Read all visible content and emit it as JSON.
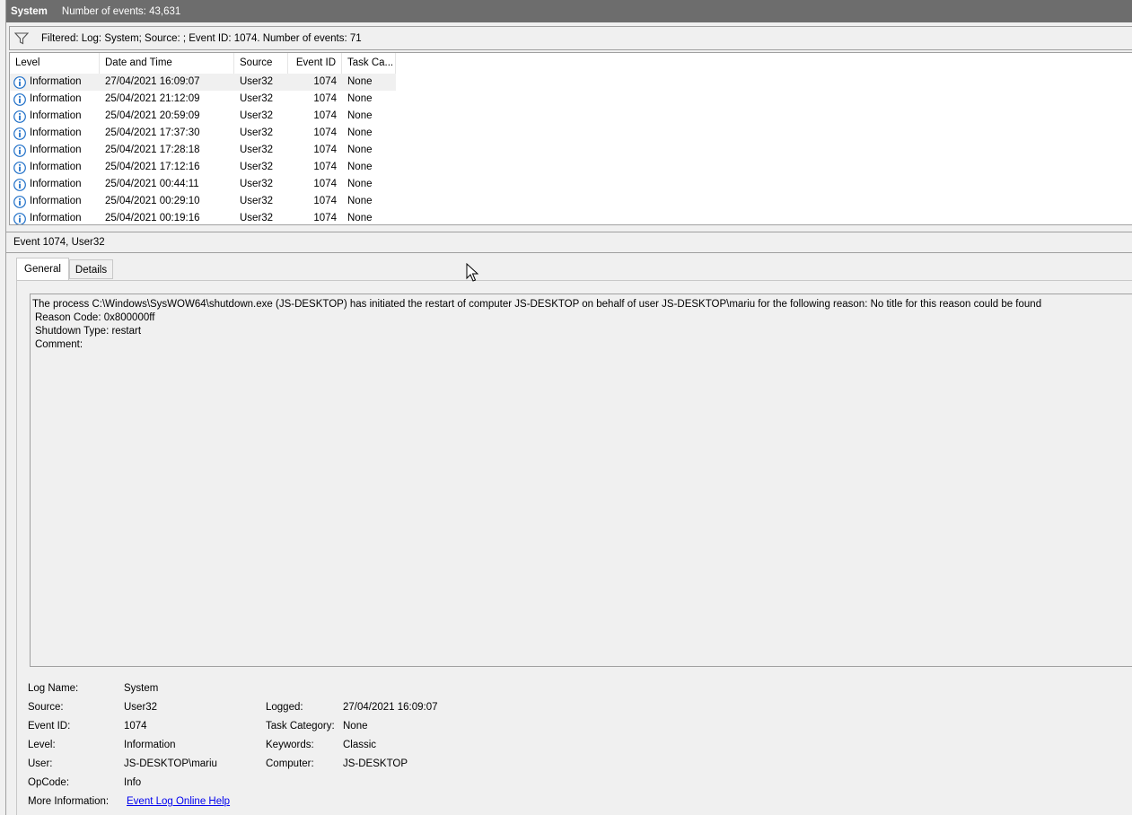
{
  "header": {
    "log_name": "System",
    "event_count": "Number of events: 43,631"
  },
  "filter": {
    "icon": "funnel-icon",
    "text": "Filtered: Log: System; Source: ; Event ID: 1074. Number of events: 71"
  },
  "grid": {
    "columns": [
      "Level",
      "Date and Time",
      "Source",
      "Event ID",
      "Task Ca..."
    ],
    "rows": [
      {
        "level": "Information",
        "date": "27/04/2021 16:09:07",
        "source": "User32",
        "event_id": "1074",
        "task": "None"
      },
      {
        "level": "Information",
        "date": "25/04/2021 21:12:09",
        "source": "User32",
        "event_id": "1074",
        "task": "None"
      },
      {
        "level": "Information",
        "date": "25/04/2021 20:59:09",
        "source": "User32",
        "event_id": "1074",
        "task": "None"
      },
      {
        "level": "Information",
        "date": "25/04/2021 17:37:30",
        "source": "User32",
        "event_id": "1074",
        "task": "None"
      },
      {
        "level": "Information",
        "date": "25/04/2021 17:28:18",
        "source": "User32",
        "event_id": "1074",
        "task": "None"
      },
      {
        "level": "Information",
        "date": "25/04/2021 17:12:16",
        "source": "User32",
        "event_id": "1074",
        "task": "None"
      },
      {
        "level": "Information",
        "date": "25/04/2021 00:44:11",
        "source": "User32",
        "event_id": "1074",
        "task": "None"
      },
      {
        "level": "Information",
        "date": "25/04/2021 00:29:10",
        "source": "User32",
        "event_id": "1074",
        "task": "None"
      },
      {
        "level": "Information",
        "date": "25/04/2021 00:19:16",
        "source": "User32",
        "event_id": "1074",
        "task": "None"
      }
    ]
  },
  "detail": {
    "title": "Event 1074, User32",
    "tabs": [
      "General",
      "Details"
    ],
    "message": [
      "The process C:\\Windows\\SysWOW64\\shutdown.exe (JS-DESKTOP) has initiated the restart of computer JS-DESKTOP on behalf of user JS-DESKTOP\\mariu for the following reason: No title for this reason could be found",
      "Reason Code: 0x800000ff",
      "Shutdown Type: restart",
      "Comment:"
    ],
    "props": {
      "log_name_label": "Log Name:",
      "log_name": "System",
      "source_label": "Source:",
      "source": "User32",
      "logged_label": "Logged:",
      "logged": "27/04/2021 16:09:07",
      "event_id_label": "Event ID:",
      "event_id": "1074",
      "task_category_label": "Task Category:",
      "task_category": "None",
      "level_label": "Level:",
      "level": "Information",
      "keywords_label": "Keywords:",
      "keywords": "Classic",
      "user_label": "User:",
      "user": "JS-DESKTOP\\mariu",
      "computer_label": "Computer:",
      "computer": "JS-DESKTOP",
      "opcode_label": "OpCode:",
      "opcode": "Info",
      "more_info_label": "More Information:",
      "more_info_link": "Event Log Online Help"
    }
  },
  "colors": {
    "topbar_bg": "#6d6d6d",
    "info_icon": "#1e6fc8",
    "link": "#0000ee"
  }
}
